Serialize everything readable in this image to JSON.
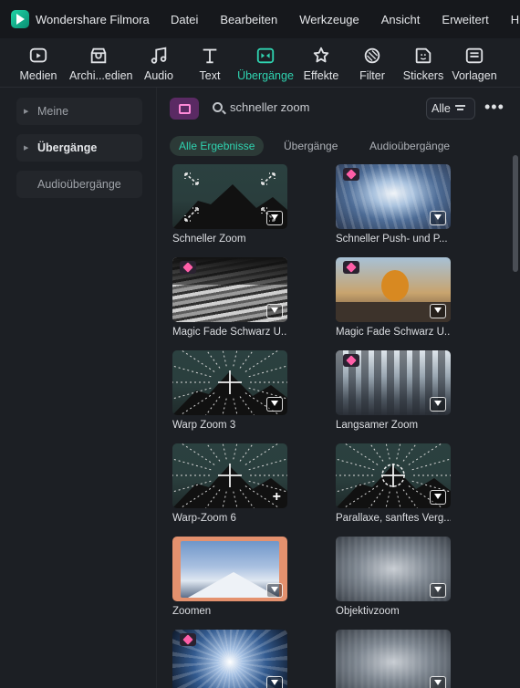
{
  "app": {
    "title": "Wondershare Filmora"
  },
  "menu": [
    "Datei",
    "Bearbeiten",
    "Werkzeuge",
    "Ansicht",
    "Erweitert",
    "Hilfe"
  ],
  "toolbar": [
    {
      "label": "Medien",
      "icon": "media-icon",
      "active": false
    },
    {
      "label": "Archi...edien",
      "icon": "stock-media-icon",
      "active": false
    },
    {
      "label": "Audio",
      "icon": "audio-icon",
      "active": false
    },
    {
      "label": "Text",
      "icon": "text-icon",
      "active": false
    },
    {
      "label": "Übergänge",
      "icon": "transitions-icon",
      "active": true
    },
    {
      "label": "Effekte",
      "icon": "effects-icon",
      "active": false
    },
    {
      "label": "Filter",
      "icon": "filter-icon",
      "active": false
    },
    {
      "label": "Stickers",
      "icon": "stickers-icon",
      "active": false
    },
    {
      "label": "Vorlagen",
      "icon": "templates-icon",
      "active": false
    }
  ],
  "sidebar": [
    {
      "label": "Meine",
      "expandable": true,
      "bold": false
    },
    {
      "label": "Übergänge",
      "expandable": true,
      "bold": true
    },
    {
      "label": "Audioübergänge",
      "expandable": false,
      "bold": false
    }
  ],
  "search": {
    "query": "schneller zoom",
    "filter_label": "Alle"
  },
  "tabs": [
    "Alle Ergebnisse",
    "Übergänge",
    "Audioübergänge"
  ],
  "results": [
    {
      "label": "Schneller Zoom",
      "premium": false,
      "action": "download",
      "art": "zoom-arrows"
    },
    {
      "label": "Schneller Push- und P...",
      "premium": true,
      "action": "download",
      "art": "push"
    },
    {
      "label": "Magic Fade Schwarz Ü...",
      "premium": true,
      "action": "download",
      "art": "fade"
    },
    {
      "label": "Magic Fade Schwarz Ü...",
      "premium": true,
      "action": "download",
      "art": "skate"
    },
    {
      "label": "Warp Zoom 3",
      "premium": false,
      "action": "download",
      "art": "zoom-rays"
    },
    {
      "label": "Langsamer Zoom",
      "premium": true,
      "action": "download",
      "art": "city"
    },
    {
      "label": "Warp-Zoom 6",
      "premium": false,
      "action": "add",
      "art": "zoom-inward"
    },
    {
      "label": "Parallaxe, sanftes Verg...",
      "premium": false,
      "action": "download",
      "art": "zoom-circle"
    },
    {
      "label": "Zoomen",
      "premium": false,
      "action": "download",
      "art": "mountain"
    },
    {
      "label": "Objektivzoom",
      "premium": false,
      "action": "download",
      "art": "blurcity"
    },
    {
      "label": "",
      "premium": true,
      "action": "download",
      "art": "tunnel"
    },
    {
      "label": "",
      "premium": false,
      "action": "download",
      "art": "blurcity"
    }
  ],
  "colors": {
    "accent": "#2fd3b0",
    "premium_gem": "#ff5ea8",
    "background": "#1c1f24"
  }
}
